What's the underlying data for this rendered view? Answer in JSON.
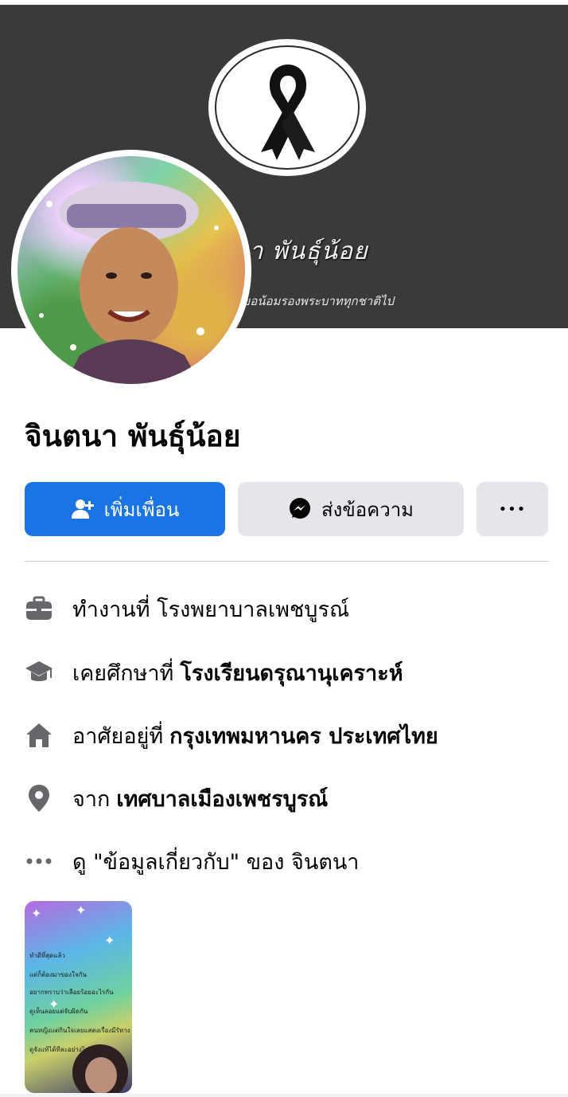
{
  "cover": {
    "name_text": "นา พันธุ์น้อย",
    "subtitle_text": "ขอน้อมรองพระบาททุกชาติไป"
  },
  "profile": {
    "name": "จินตนา พันธ์ุน้อย"
  },
  "actions": {
    "add_friend": "เพิ่มเพื่อน",
    "message": "ส่งข้อความ",
    "more": "•••"
  },
  "info": {
    "work": {
      "prefix": "ทำงานที่ โรงพยาบาลเพชบูรณ์",
      "value": "",
      "icon": "briefcase-icon"
    },
    "education": {
      "prefix": "เคยศึกษาที่",
      "value": "โรงเรียนดรุณานุเคราะห์",
      "icon": "graduation-cap-icon"
    },
    "lives": {
      "prefix": "อาศัยอยู่ที่",
      "value": "กรุงเทพมหานคร ประเทศไทย",
      "icon": "home-icon"
    },
    "from": {
      "prefix": "จาก",
      "value": "เทศบาลเมืองเพชรบูรณ์",
      "icon": "location-pin-icon"
    },
    "about": {
      "text": "ดู \"ข้อมูลเกี่ยวกับ\" ของ จินตนา",
      "icon": "more-dots-icon"
    }
  },
  "story": {
    "lines": [
      "ทำดีที่สุดแล้ว",
      "แต่ก็ต้องมาของใจกัน",
      "อยากทราบว่าเลือยร้อยอะไรกัน",
      "ดูเห็นลอยแต่จับผิดกัน",
      "คนหญิงแต่กินใจเลยแสดงเรื่องมีรัทาง",
      "ดูจังแท้ได้ทีละอย่างไม่ต่อ"
    ]
  },
  "colors": {
    "primary": "#1b74e4",
    "secondary_button": "#e4e6eb",
    "cover_bg": "#3a3a3a",
    "icon_gray": "#65676b"
  }
}
